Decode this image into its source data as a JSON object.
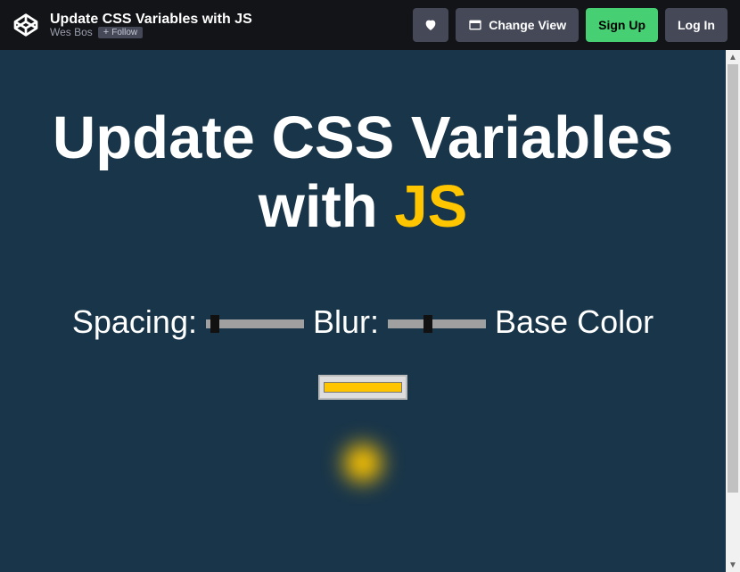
{
  "header": {
    "title": "Update CSS Variables with JS",
    "author": "Wes Bos",
    "follow_label": "Follow",
    "change_view_label": "Change View",
    "signup_label": "Sign Up",
    "login_label": "Log In"
  },
  "page": {
    "heading_pre": "Update CSS Variables with ",
    "heading_hl": "JS",
    "controls": {
      "spacing_label": "Spacing:",
      "blur_label": "Blur:",
      "color_label": "Base Color",
      "spacing_value": "10",
      "blur_value": "10",
      "base_color": "#ffc600"
    }
  }
}
